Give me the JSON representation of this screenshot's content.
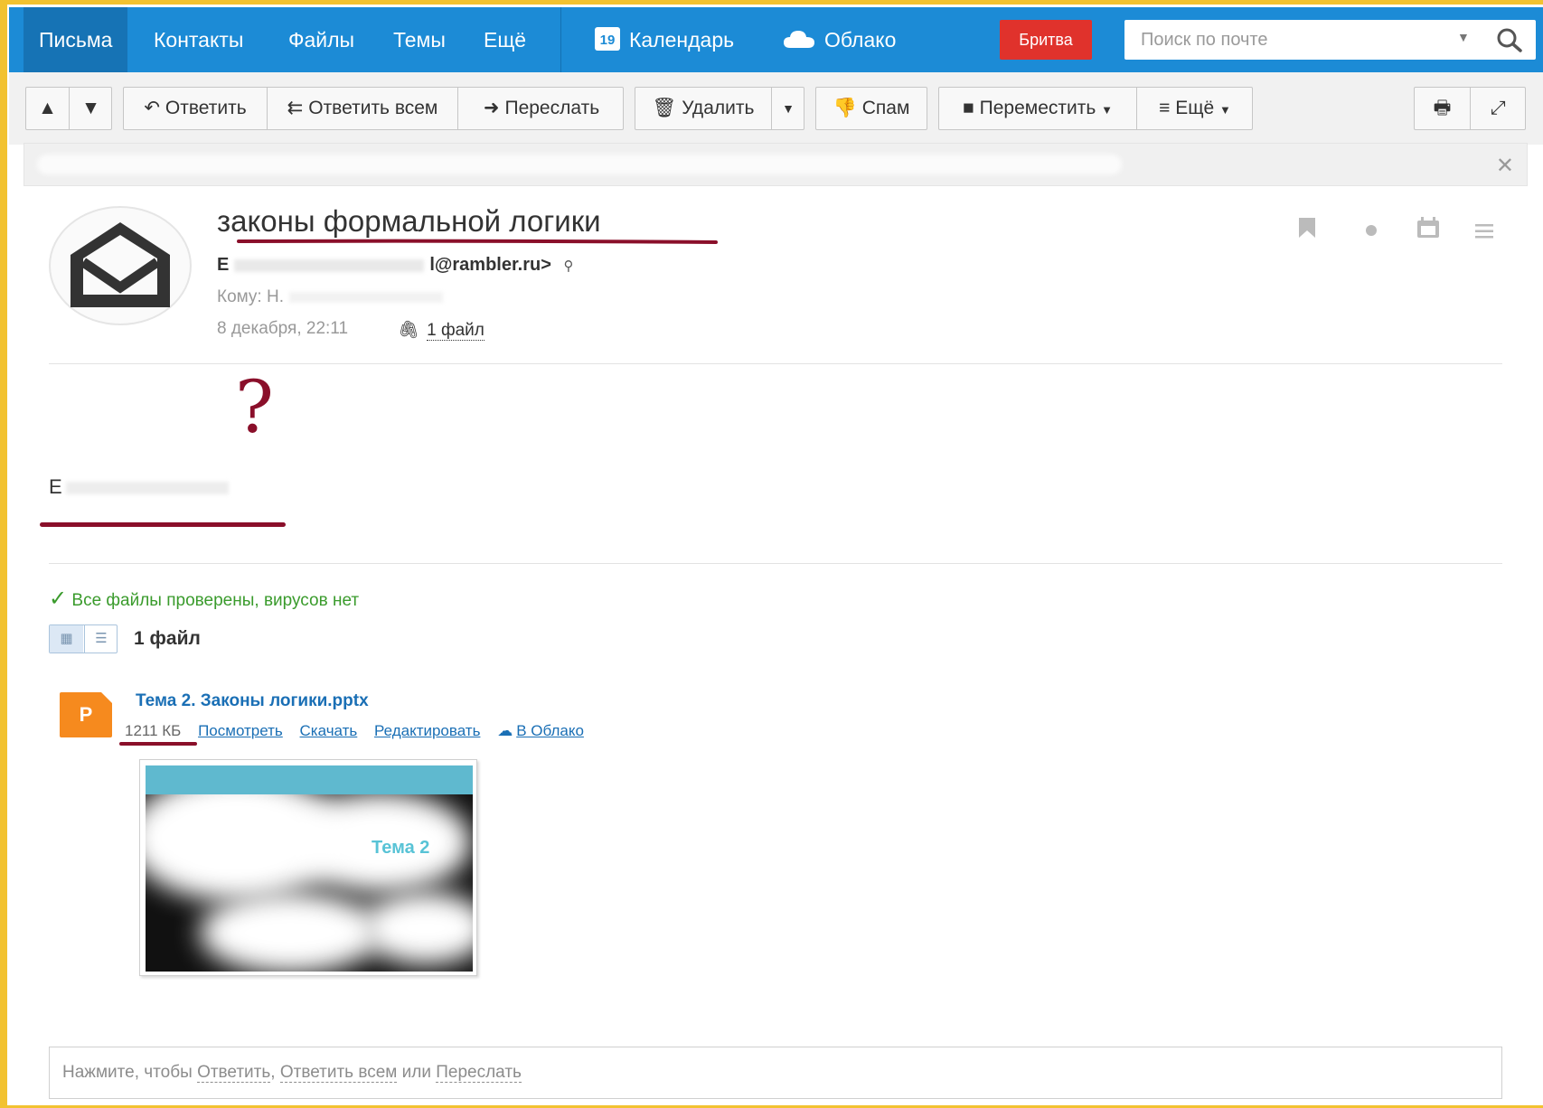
{
  "nav": {
    "letters": "Письма",
    "contacts": "Контакты",
    "files": "Файлы",
    "themes": "Темы",
    "more": "Ещё",
    "calendar_day": "19",
    "calendar": "Календарь",
    "cloud": "Облако",
    "britva": "Бритва",
    "search_placeholder": "Поиск по почте"
  },
  "toolbar": {
    "reply": "Ответить",
    "reply_all": "Ответить всем",
    "forward": "Переслать",
    "delete": "Удалить",
    "spam": "Спам",
    "move": "Переместить",
    "more": "≡ Ещё"
  },
  "message": {
    "subject": "законы формальной логики",
    "from_prefix": "Е",
    "from_email": "l@rambler.ru>",
    "to_prefix": "Кому: Н.",
    "date": "8 декабря, 22:11",
    "attachments_link": "1 файл",
    "signature_prefix": "Е",
    "question_mark": "?"
  },
  "attachments": {
    "scan_status": "Все файлы проверены, вирусов нет",
    "count_label": "1 файл",
    "files": [
      {
        "type_letter": "P",
        "name": "Тема 2. Законы логики.pptx",
        "size": "1211 КБ",
        "view": "Посмотреть",
        "download": "Скачать",
        "edit": "Редактировать",
        "to_cloud": "В Облако",
        "preview_title": "Тема 2"
      }
    ]
  },
  "reply_box": {
    "prefix": "Нажмите, чтобы ",
    "reply": "Ответить",
    "comma": ", ",
    "reply_all": "Ответить всем",
    "or": " или ",
    "forward": "Переслать"
  },
  "colors": {
    "nav_bg": "#1c8bd6",
    "nav_active": "#1673b5",
    "britva": "#e0322c",
    "link": "#1a6fb5",
    "success": "#3a9b2c",
    "annotation": "#8a0f2a",
    "frame": "#f2c230"
  },
  "icons": [
    "calendar-icon",
    "cloud-icon",
    "search-icon",
    "arrow-up-icon",
    "arrow-down-icon",
    "reply-icon",
    "reply-all-icon",
    "forward-icon",
    "trash-icon",
    "spam-icon",
    "folder-icon",
    "printer-icon",
    "expand-icon",
    "envelope-icon",
    "bookmark-icon",
    "dot-icon",
    "calendar-small-icon",
    "menu-icon",
    "paperclip-icon",
    "checkmark-icon",
    "grid-view-icon",
    "list-view-icon",
    "cloud-upload-icon",
    "close-icon"
  ]
}
